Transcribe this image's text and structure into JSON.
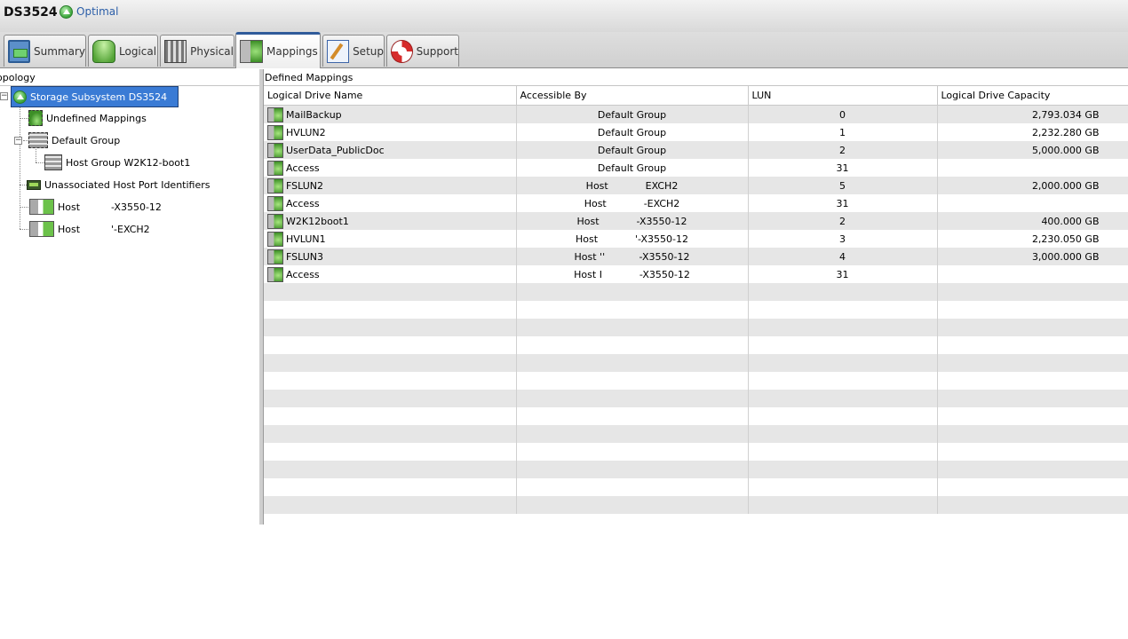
{
  "app": {
    "title": "DS3524",
    "status": "Optimal"
  },
  "tabs": [
    {
      "label": "Summary",
      "icon": "summary-icon"
    },
    {
      "label": "Logical",
      "icon": "logical-icon"
    },
    {
      "label": "Physical",
      "icon": "physical-icon"
    },
    {
      "label": "Mappings",
      "icon": "mappings-icon",
      "active": true
    },
    {
      "label": "Setup",
      "icon": "setup-icon"
    },
    {
      "label": "Support",
      "icon": "support-icon"
    }
  ],
  "tree": {
    "title": "opology",
    "nodes": [
      {
        "label": "Storage Subsystem DS3524",
        "icon": "storage-subsystem-icon",
        "selected": true
      },
      {
        "label": "Undefined Mappings",
        "icon": "undefined-mappings-icon"
      },
      {
        "label": "Default Group",
        "icon": "default-group-icon"
      },
      {
        "label": "Host Group W2K12-boot1",
        "icon": "host-group-icon"
      },
      {
        "label": "Unassociated Host Port Identifiers",
        "icon": "host-port-icon"
      },
      {
        "label": "Host          -X3550-12",
        "icon": "host-icon"
      },
      {
        "label": "Host          '-EXCH2",
        "icon": "host-icon"
      }
    ]
  },
  "mappings": {
    "title": "Defined Mappings",
    "columns": [
      "Logical Drive Name",
      "Accessible By",
      "LUN",
      "Logical Drive Capacity"
    ],
    "rows": [
      {
        "name": "MailBackup",
        "access": "Default Group",
        "lun": "0",
        "capacity": "2,793.034 GB"
      },
      {
        "name": "HVLUN2",
        "access": "Default Group",
        "lun": "1",
        "capacity": "2,232.280 GB"
      },
      {
        "name": "UserData_PublicDoc",
        "access": "Default Group",
        "lun": "2",
        "capacity": "5,000.000 GB"
      },
      {
        "name": "Access",
        "access": "Default Group",
        "lun": "31",
        "capacity": ""
      },
      {
        "name": "FSLUN2",
        "access": "Host            EXCH2",
        "lun": "5",
        "capacity": "2,000.000 GB"
      },
      {
        "name": "Access",
        "access": "Host            -EXCH2",
        "lun": "31",
        "capacity": ""
      },
      {
        "name": "W2K12boot1",
        "access": "Host            -X3550-12",
        "lun": "2",
        "capacity": "400.000 GB"
      },
      {
        "name": "HVLUN1",
        "access": "Host            '-X3550-12",
        "lun": "3",
        "capacity": "2,230.050 GB"
      },
      {
        "name": "FSLUN3",
        "access": "Host ''           -X3550-12",
        "lun": "4",
        "capacity": "3,000.000 GB"
      },
      {
        "name": "Access",
        "access": "Host I            -X3550-12",
        "lun": "31",
        "capacity": ""
      }
    ]
  }
}
